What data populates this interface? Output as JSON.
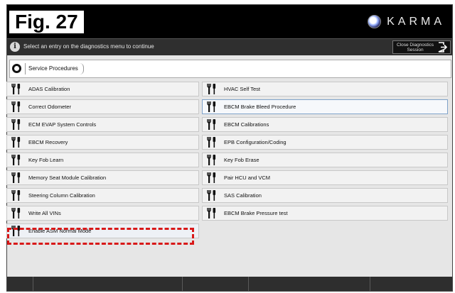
{
  "figure_label": "Fig. 27",
  "brand": {
    "name": "KARMA",
    "logo_icon": "karma-logo-icon"
  },
  "info_bar": {
    "icon": "info-icon",
    "message": "Select an entry on the diagnostics menu to continue",
    "close_button": {
      "label_line1": "Close Diagnostics",
      "label_line2": "Session",
      "icon": "exit-icon"
    }
  },
  "breadcrumb": {
    "home_icon": "home-circle-icon",
    "items": [
      "Service Procedures"
    ]
  },
  "entries": [
    {
      "label": "ADAS Calibration",
      "icon": "wrench-screwdriver-icon"
    },
    {
      "label": "HVAC Self Test",
      "icon": "wrench-screwdriver-icon"
    },
    {
      "label": "Correct Odometer",
      "icon": "wrench-screwdriver-icon"
    },
    {
      "label": "EBCM Brake Bleed Procedure",
      "icon": "wrench-screwdriver-icon",
      "selected": true
    },
    {
      "label": "ECM EVAP System Controls",
      "icon": "wrench-screwdriver-icon"
    },
    {
      "label": "EBCM Calibrations",
      "icon": "wrench-screwdriver-icon"
    },
    {
      "label": "EBCM Recovery",
      "icon": "wrench-screwdriver-icon"
    },
    {
      "label": "EPB Configuration/Coding",
      "icon": "wrench-screwdriver-icon"
    },
    {
      "label": "Key Fob Learn",
      "icon": "wrench-screwdriver-icon"
    },
    {
      "label": "Key Fob Erase",
      "icon": "wrench-screwdriver-icon"
    },
    {
      "label": "Memory Seat Module Calibration",
      "icon": "wrench-screwdriver-icon"
    },
    {
      "label": "Pair HCU and VCM",
      "icon": "wrench-screwdriver-icon"
    },
    {
      "label": "Steering Column Calibration",
      "icon": "wrench-screwdriver-icon"
    },
    {
      "label": "SAS Calibration",
      "icon": "wrench-screwdriver-icon"
    },
    {
      "label": "Write All VINs",
      "icon": "wrench-screwdriver-icon"
    },
    {
      "label": "EBCM Brake Pressure test",
      "icon": "wrench-screwdriver-icon"
    },
    {
      "label": "Enable ASM Normal Mode",
      "icon": "wrench-screwdriver-icon",
      "highlighted": true
    }
  ],
  "colors": {
    "highlight_dash": "#d81919",
    "selected_border": "#7fa2c9",
    "topbar": "#000000"
  },
  "footer_buttons": [
    "",
    "",
    "",
    "",
    ""
  ]
}
